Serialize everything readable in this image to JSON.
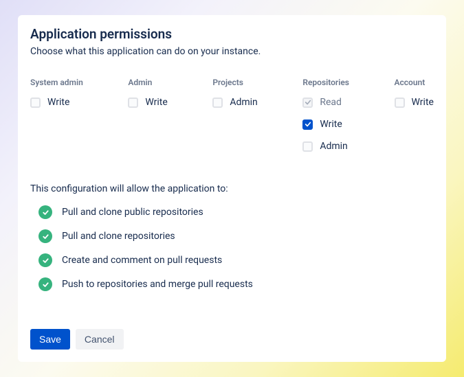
{
  "header": {
    "title": "Application permissions",
    "subtitle": "Choose what this application can do on your instance."
  },
  "columns": {
    "system_admin": {
      "header": "System admin",
      "options": [
        {
          "label": "Write",
          "state": "empty"
        }
      ]
    },
    "admin": {
      "header": "Admin",
      "options": [
        {
          "label": "Write",
          "state": "empty"
        }
      ]
    },
    "projects": {
      "header": "Projects",
      "options": [
        {
          "label": "Admin",
          "state": "empty"
        }
      ]
    },
    "repositories": {
      "header": "Repositories",
      "options": [
        {
          "label": "Read",
          "state": "disabled-checked"
        },
        {
          "label": "Write",
          "state": "checked"
        },
        {
          "label": "Admin",
          "state": "empty"
        }
      ]
    },
    "account": {
      "header": "Account",
      "options": [
        {
          "label": "Write",
          "state": "empty"
        }
      ]
    }
  },
  "config": {
    "intro": "This configuration will allow the application to:",
    "items": [
      "Pull and clone public repositories",
      "Pull and clone repositories",
      "Create and comment on pull requests",
      "Push to repositories and merge pull requests"
    ]
  },
  "buttons": {
    "save": "Save",
    "cancel": "Cancel"
  }
}
